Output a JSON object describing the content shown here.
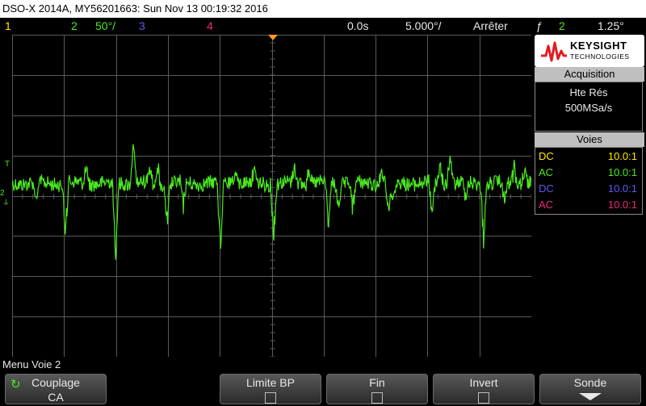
{
  "title": "DSO-X 2014A, MY56201663: Sun Nov 13 00:19:32 2016",
  "status": {
    "ch1": "1",
    "ch2": "2",
    "ch2_scale": "50°/",
    "ch3": "3",
    "ch4": "4",
    "time_pos": "0.0s",
    "time_scale": "5.000°/",
    "run_state": "Arrêter",
    "trigger_channel": "2",
    "trigger_level": "1.25°"
  },
  "colors": {
    "ch1": "#ffe800",
    "ch2": "#4be81f",
    "ch3": "#5a5cf5",
    "ch4": "#f0277d",
    "grid": "#5a5a5a",
    "trigger_marker": "#ff9a1e"
  },
  "logo": {
    "main": "KEYSIGHT",
    "sub": "TECHNOLOGIES"
  },
  "acquisition": {
    "header": "Acquisition",
    "mode": "Hte Rés",
    "rate": "500MSa/s"
  },
  "channels_panel": {
    "header": "Voies",
    "rows": [
      {
        "coupling": "DC",
        "probe": "10.0:1",
        "color": "#ffe800"
      },
      {
        "coupling": "AC",
        "probe": "10.0:1",
        "color": "#4be81f"
      },
      {
        "coupling": "DC",
        "probe": "10.0:1",
        "color": "#5a5cf5"
      },
      {
        "coupling": "AC",
        "probe": "10.0:1",
        "color": "#f0277d"
      }
    ]
  },
  "markers": {
    "trigger_level": "T",
    "ch2_ground": "2"
  },
  "menu": {
    "title": "Menu Voie 2",
    "softkeys": [
      {
        "label": "Couplage",
        "value": "CA",
        "icon": "rotate-icon"
      },
      {
        "label": "Limite BP",
        "icon": "checkbox-icon"
      },
      {
        "label": "Fin",
        "icon": "checkbox-icon"
      },
      {
        "label": "Invert",
        "icon": "checkbox-icon"
      },
      {
        "label": "Sonde",
        "icon": "arrow-down-icon"
      }
    ]
  }
}
